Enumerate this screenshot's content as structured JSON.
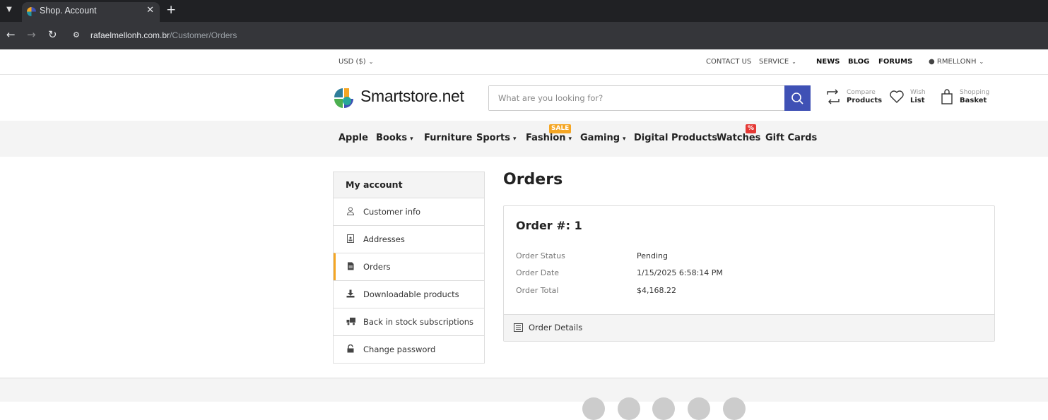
{
  "browser": {
    "tab_title": "Shop. Account",
    "url_host": "rafaelmellonh.com.br",
    "url_path": "/Customer/Orders"
  },
  "topbar": {
    "currency": "USD  ($)",
    "contact": "CONTACT US",
    "service": "SERVICE",
    "news": "NEWS",
    "blog": "BLOG",
    "forums": "FORUMS",
    "user": "RMELLONH"
  },
  "header": {
    "logo_text": "Smartstore.net",
    "search_placeholder": "What are you looking for?",
    "compare_small": "Compare",
    "compare_big": "Products",
    "wish_small": "Wish",
    "wish_big": "List",
    "basket_small": "Shopping",
    "basket_big": "Basket"
  },
  "menu": {
    "items": [
      "Apple",
      "Books",
      "Furniture",
      "Sports",
      "Fashion",
      "Gaming",
      "Digital Products",
      "Watches",
      "Gift Cards"
    ],
    "sale_badge": "SALE",
    "percent_badge": "%",
    "colors": {
      "sale": "#f5a623",
      "percent": "#e53935",
      "search": "#3f51b5",
      "active": "#f5a623"
    }
  },
  "sidebar": {
    "title": "My account",
    "items": [
      {
        "label": "Customer info",
        "icon": "user-icon"
      },
      {
        "label": "Addresses",
        "icon": "address-book-icon"
      },
      {
        "label": "Orders",
        "icon": "document-icon"
      },
      {
        "label": "Downloadable products",
        "icon": "download-icon"
      },
      {
        "label": "Back in stock subscriptions",
        "icon": "truck-icon"
      },
      {
        "label": "Change password",
        "icon": "lock-icon"
      }
    ]
  },
  "main": {
    "title": "Orders",
    "order": {
      "title": "Order #: 1",
      "status_label": "Order Status",
      "status_value": "Pending",
      "date_label": "Order Date",
      "date_value": "1/15/2025 6:58:14 PM",
      "total_label": "Order Total",
      "total_value": "$4,168.22",
      "details_label": "Order Details"
    }
  }
}
